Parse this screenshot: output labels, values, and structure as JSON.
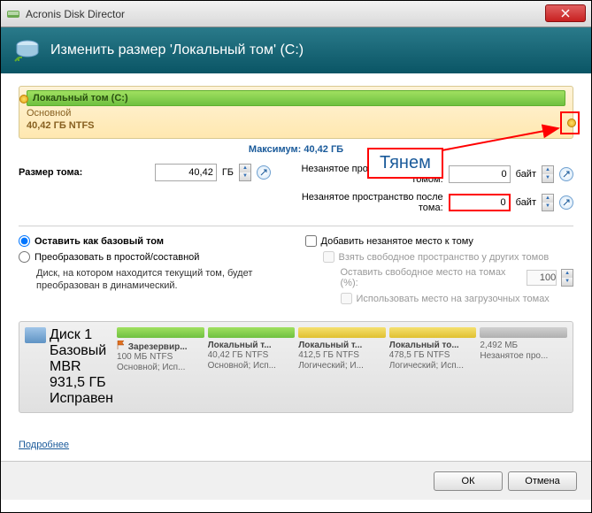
{
  "window": {
    "title": "Acronis Disk Director"
  },
  "header": {
    "title": "Изменить размер 'Локальный том' (C:)"
  },
  "slider": {
    "volume_name": "Локальный том (C:)",
    "line1": "Основной",
    "line2": "40,42 ГБ NTFS",
    "maximum_label": "Максимум: 40,42 ГБ"
  },
  "fields": {
    "size_label": "Размер тома:",
    "size_value": "40,42",
    "size_unit": "ГБ",
    "before_label": "Незанятое пространство перед томом:",
    "before_value": "0",
    "before_unit": "байт",
    "after_label": "Незанятое пространство после тома:",
    "after_value": "0",
    "after_unit": "байт"
  },
  "options": {
    "keep_basic": "Оставить как базовый том",
    "convert": "Преобразовать в простой/составной",
    "note": "Диск, на котором находится текущий том, будет преобразован в динамический.",
    "add_unalloc": "Добавить незанятое место к тому",
    "take_free": "Взять свободное пространство у других томов",
    "leave_free": "Оставить свободное место на томах (%):",
    "leave_free_value": "100",
    "use_boot": "Использовать место на загрузочных томах"
  },
  "disks": [
    {
      "bar": "first",
      "title": "Диск 1",
      "sub1": "Базовый MBR",
      "sub2": "931,5 ГБ",
      "sub3": "Исправен"
    },
    {
      "bar": "green",
      "flag": true,
      "title": "Зарезервир...",
      "sub1": "100 МБ NTFS",
      "sub2": "Основной; Исп..."
    },
    {
      "bar": "green",
      "title": "Локальный т...",
      "sub1": "40,42 ГБ NTFS",
      "sub2": "Основной; Исп..."
    },
    {
      "bar": "yellow",
      "title": "Локальный т...",
      "sub1": "412,5 ГБ NTFS",
      "sub2": "Логический; И..."
    },
    {
      "bar": "yellow",
      "title": "Локальный то...",
      "sub1": "478,5 ГБ NTFS",
      "sub2": "Логический; Исп..."
    },
    {
      "bar": "grey",
      "title": "",
      "sub1": "2,492 МБ",
      "sub2": "Незанятое про..."
    }
  ],
  "link": "Подробнее",
  "buttons": {
    "ok": "ОК",
    "cancel": "Отмена"
  },
  "annotation": {
    "label": "Тянем"
  }
}
